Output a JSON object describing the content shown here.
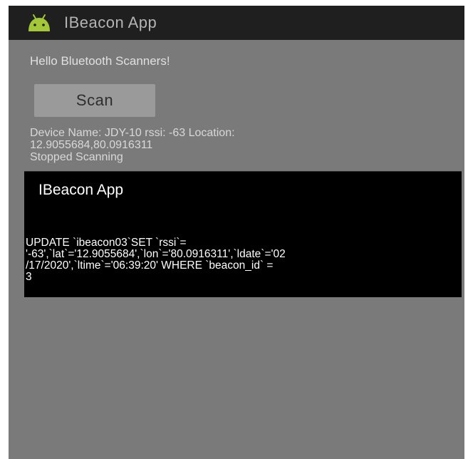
{
  "action_bar": {
    "icon": "android-icon",
    "icon_color": "#a4c639",
    "background": "#1f1f1f",
    "title": "IBeacon App"
  },
  "main": {
    "background": "#7a7a7a",
    "greeting": "Hello Bluetooth Scanners!",
    "scan_button_label": "Scan",
    "status_lines": [
      "Device Name: JDY-10 rssi: -63 Location:",
      "12.9055684,80.0916311",
      "Stopped Scanning"
    ]
  },
  "dialog": {
    "background": "#000000",
    "title": "IBeacon App",
    "message_lines": [
      "UPDATE `ibeacon03`SET `rssi`=",
      "'-63',`lat`='12.9055684',`lon`='80.0916311',`ldate`='02",
      "/17/2020',`ltime`='06:39:20' WHERE `beacon_id` =",
      "3"
    ]
  }
}
